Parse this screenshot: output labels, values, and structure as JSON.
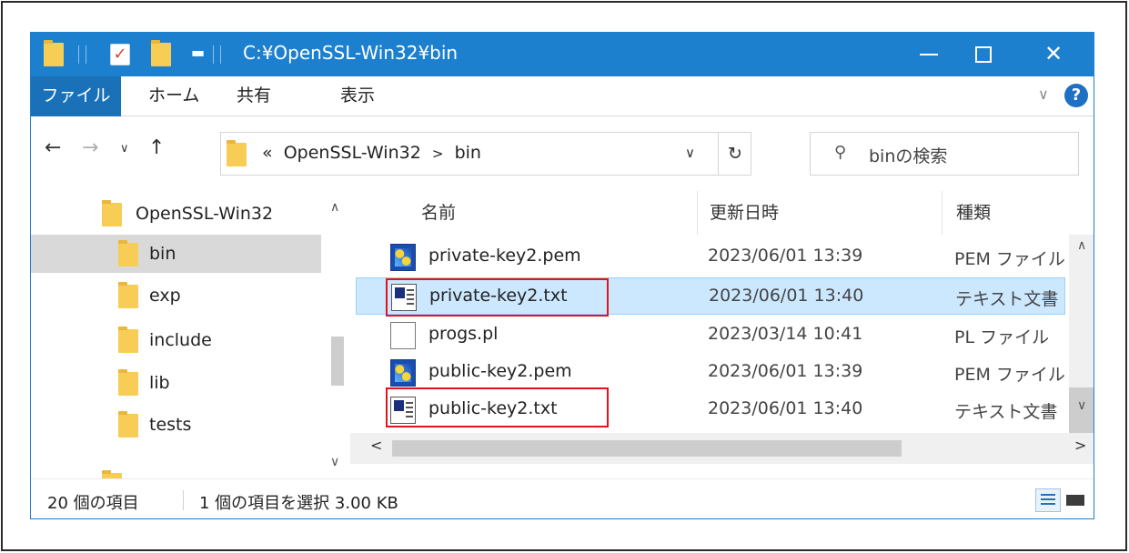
{
  "window": {
    "title": "C:¥OpenSSL-Win32¥bin",
    "colors": {
      "titlebar": "#1c80cf",
      "file_tab": "#1a71b7",
      "selection": "#cce8ff",
      "highlight_box": "#e0141a"
    }
  },
  "quick_access": {
    "icons": [
      "folder-icon",
      "properties-check-icon",
      "new-folder-icon",
      "customize-dropdown-icon"
    ]
  },
  "ribbon": {
    "tabs": [
      "ファイル",
      "ホーム",
      "共有",
      "表示"
    ],
    "help": "?"
  },
  "address": {
    "overflow": "«",
    "crumbs": [
      "OpenSSL-Win32",
      "bin"
    ],
    "separator": ">"
  },
  "search": {
    "placeholder": "binの検索"
  },
  "tree": {
    "items": [
      {
        "label": "OpenSSL-Win32",
        "selected": false
      },
      {
        "label": "bin",
        "selected": true
      },
      {
        "label": "exp",
        "selected": false
      },
      {
        "label": "include",
        "selected": false
      },
      {
        "label": "lib",
        "selected": false
      },
      {
        "label": "tests",
        "selected": false
      }
    ]
  },
  "columns": {
    "name": "名前",
    "date": "更新日時",
    "type": "種類"
  },
  "files": [
    {
      "name": "private-key2.pem",
      "date": "2023/06/01 13:39",
      "type": "PEM ファイル",
      "icon": "pem-icon",
      "selected": false,
      "boxed": false
    },
    {
      "name": "private-key2.txt",
      "date": "2023/06/01 13:40",
      "type": "テキスト文書",
      "icon": "text-document-icon",
      "selected": true,
      "boxed": true
    },
    {
      "name": "progs.pl",
      "date": "2023/03/14 10:41",
      "type": "PL ファイル",
      "icon": "document-icon",
      "selected": false,
      "boxed": false
    },
    {
      "name": "public-key2.pem",
      "date": "2023/06/01 13:39",
      "type": "PEM ファイル",
      "icon": "pem-icon",
      "selected": false,
      "boxed": false
    },
    {
      "name": "public-key2.txt",
      "date": "2023/06/01 13:40",
      "type": "テキスト文書",
      "icon": "text-document-icon",
      "selected": false,
      "boxed": true
    }
  ],
  "status": {
    "item_count": "20 個の項目",
    "selection": "1 個の項目を選択  3.00 KB"
  }
}
